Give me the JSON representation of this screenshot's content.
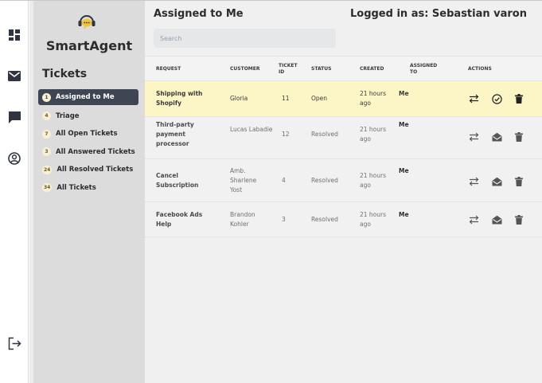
{
  "app": {
    "brand": "SmartAgent",
    "accent": "#3e4653",
    "highlight_row_color": "#fcf6c6"
  },
  "rail": {
    "icons": [
      "dashboard-icon",
      "mail-icon",
      "chat-icon",
      "user-circle-icon",
      "logout-icon"
    ]
  },
  "sidebar": {
    "heading": "Tickets",
    "items": [
      {
        "count": "1",
        "label": "Assigned to Me",
        "active": true
      },
      {
        "count": "4",
        "label": "Triage",
        "active": false
      },
      {
        "count": "7",
        "label": "All Open Tickets",
        "active": false
      },
      {
        "count": "3",
        "label": "All Answered Tickets",
        "active": false
      },
      {
        "count": "24",
        "label": "All Resolved Tickets",
        "active": false
      },
      {
        "count": "34",
        "label": "All Tickets",
        "active": false
      }
    ]
  },
  "header": {
    "title": "Assigned to Me",
    "login_text": "Logged in as: Sebastian varon",
    "search_placeholder": "Search"
  },
  "table": {
    "columns": {
      "request": "REQUEST",
      "customer": "CUSTOMER",
      "ticket_id": "TICKET ID",
      "status": "STATUS",
      "created": "CREATED",
      "assigned_to": "ASSIGNED TO",
      "actions": "ACTIONS"
    },
    "rows": [
      {
        "request": "Shipping with Shopify",
        "customer": "Gloria",
        "ticket_id": "11",
        "status": "Open",
        "created": "21 hours ago",
        "assigned_to": "Me",
        "second_action": "check-circle-icon"
      },
      {
        "request": "Third-party payment processor",
        "customer": "Lucas Labadie",
        "ticket_id": "12",
        "status": "Resolved",
        "created": "21 hours ago",
        "assigned_to": "Me",
        "second_action": "open-mail-icon"
      },
      {
        "request": "Cancel Subscription",
        "customer": "Amb. Sharlene Yost",
        "ticket_id": "4",
        "status": "Resolved",
        "created": "21 hours ago",
        "assigned_to": "Me",
        "second_action": "open-mail-icon"
      },
      {
        "request": "Facebook Ads Help",
        "customer": "Brandon Kohler",
        "ticket_id": "3",
        "status": "Resolved",
        "created": "21 hours ago",
        "assigned_to": "Me",
        "second_action": "open-mail-icon"
      }
    ]
  }
}
